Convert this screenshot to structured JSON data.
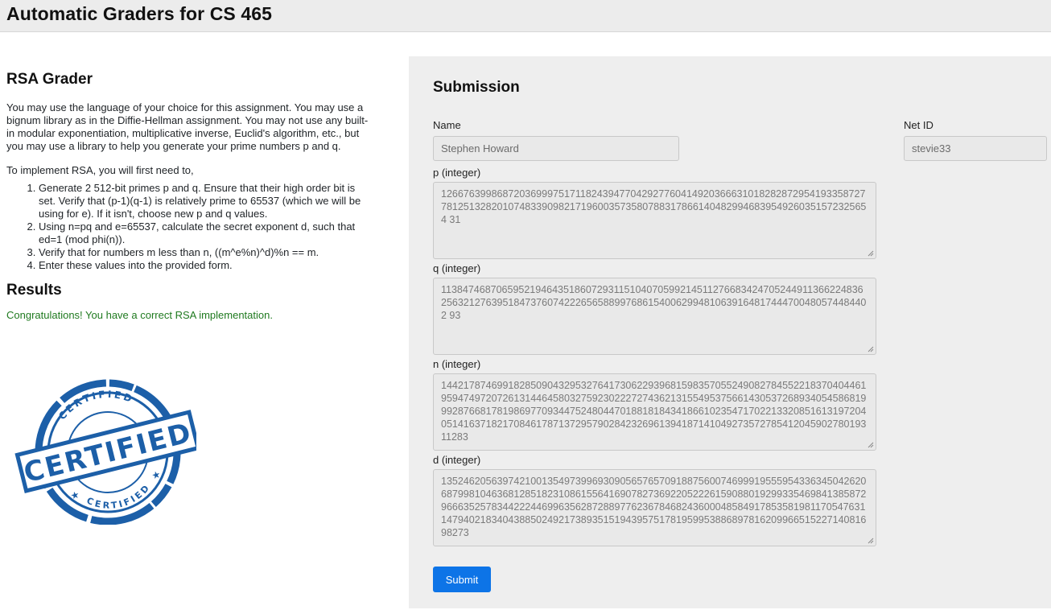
{
  "header": {
    "title": "Automatic Graders for CS 465"
  },
  "grader": {
    "title": "RSA Grader",
    "intro": "You may use the language of your choice for this assignment. You may use a bignum library as in the Diffie-Hellman assignment. You may not use any built-in modular exponentiation, multiplicative inverse, Euclid's algorithm, etc., but you may use a library to help you generate your prime numbers p and q.",
    "implement": "To implement RSA, you will first need to,",
    "steps": [
      "Generate 2 512-bit primes p and q. Ensure that their high order bit is set. Verify that (p-1)(q-1) is relatively prime to 65537 (which we will be using for e). If it isn't, choose new p and q values.",
      "Using n=pq and e=65537, calculate the secret exponent d, such that ed=1 (mod phi(n)).",
      "Verify that for numbers m less than n, ((m^e%n)^d)%n == m.",
      "Enter these values into the provided form."
    ]
  },
  "results": {
    "title": "Results",
    "message": "Congratulations! You have a correct RSA implementation.",
    "stamp": {
      "arc_text_top": "CERTIFIED",
      "main_text": "CERTIFIED",
      "arc_text_bottom": "CERTIFIED"
    }
  },
  "submission": {
    "title": "Submission",
    "name_label": "Name",
    "name_value": "Stephen Howard",
    "netid_label": "Net ID",
    "netid_value": "stevie33",
    "p_label": "p (integer)",
    "p_value": "126676399868720369997517118243947704292776041492036663101828287295419335872778125132820107483390982171960035735807883178661404829946839549260351572325654 31",
    "q_label": "q (integer)",
    "q_value": "113847468706595219464351860729311510407059921451127668342470524491136622483625632127639518473760742226565889976861540062994810639164817444700480574484402 93",
    "n_label": "n (integer)",
    "n_value": "144217874699182850904329532764173062293968159835705524908278455221837040446195947497207261314464580327592302227274362131554953756614305372689340545868199928766817819869770934475248044701881818434186610235471702213320851613197204051416371821708461787137295790284232696139418714104927357278541204590278019311283",
    "d_label": "d (integer)",
    "d_value": "135246205639742100135497399693090565765709188756007469991955595433634504262068799810463681285182310861556416907827369220522261590880192993354698413858729666352578344222446996356287288977623678468243600048584917853581981170547631147940218340438850249217389351519439575178195995388689781620996651522714081698273",
    "submit_label": "Submit"
  },
  "colors": {
    "accent": "#0d74e7",
    "success": "#1f7a1f",
    "stamp": "#1c5fa8",
    "panel": "#eeeeee",
    "topbar": "#ececec"
  }
}
